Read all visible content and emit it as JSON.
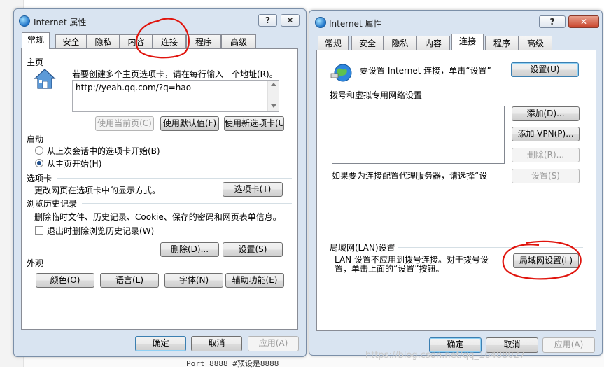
{
  "background": {
    "bottom_text": "Port 8888    #预设是8888"
  },
  "left_window": {
    "title": "Internet 属性",
    "help_button": "?",
    "close_button": "✕",
    "tabs": [
      "常规",
      "安全",
      "隐私",
      "内容",
      "连接",
      "程序",
      "高级"
    ],
    "active_tab": "常规",
    "homepage": {
      "group_label": "主页",
      "description": "若要创建多个主页选项卡，请在每行输入一个地址(R)。",
      "url_value": "http://yeah.qq.com/?q=hao",
      "use_current_button": "使用当前页(C)",
      "use_default_button": "使用默认值(F)",
      "use_new_tab_button": "使用新选项卡(U)"
    },
    "startup": {
      "group_label": "启动",
      "option_last_session": "从上次会话中的选项卡开始(B)",
      "option_home": "从主页开始(H)",
      "selected": "从主页开始(H)"
    },
    "tabs_group": {
      "group_label": "选项卡",
      "description": "更改网页在选项卡中的显示方式。",
      "tabs_button": "选项卡(T)"
    },
    "history": {
      "group_label": "浏览历史记录",
      "description": "删除临时文件、历史记录、Cookie、保存的密码和网页表单信息。",
      "delete_on_exit_label": "退出时删除浏览历史记录(W)",
      "delete_on_exit_checked": false,
      "delete_button": "删除(D)...",
      "settings_button": "设置(S)"
    },
    "appearance": {
      "group_label": "外观",
      "colors_button": "颜色(O)",
      "languages_button": "语言(L)",
      "fonts_button": "字体(N)",
      "accessibility_button": "辅助功能(E)"
    },
    "footer": {
      "ok": "确定",
      "cancel": "取消",
      "apply": "应用(A)"
    }
  },
  "right_window": {
    "title": "Internet 属性",
    "help_button": "?",
    "close_button": "✕",
    "tabs": [
      "常规",
      "安全",
      "隐私",
      "内容",
      "连接",
      "程序",
      "高级"
    ],
    "active_tab": "连接",
    "setup": {
      "description": "要设置 Internet 连接，单击“设置”",
      "setup_button": "设置(U)"
    },
    "dialup": {
      "group_label": "拨号和虚拟专用网络设置",
      "add_button": "添加(D)...",
      "add_vpn_button": "添加 VPN(P)...",
      "remove_button": "删除(R)...",
      "settings_button": "设置(S)",
      "proxy_note": "如果要为连接配置代理服务器，请选择“设"
    },
    "lan": {
      "group_label": "局域网(LAN)设置",
      "description_line1": "LAN 设置不应用到拨号连接。对于拨号设",
      "description_line2": "置，单击上面的“设置”按钮。",
      "lan_settings_button": "局域网设置(L)"
    },
    "footer": {
      "ok": "确定",
      "cancel": "取消",
      "apply": "应用(A)"
    }
  },
  "watermark": "https://blog.csdn.net/qq_16488027"
}
